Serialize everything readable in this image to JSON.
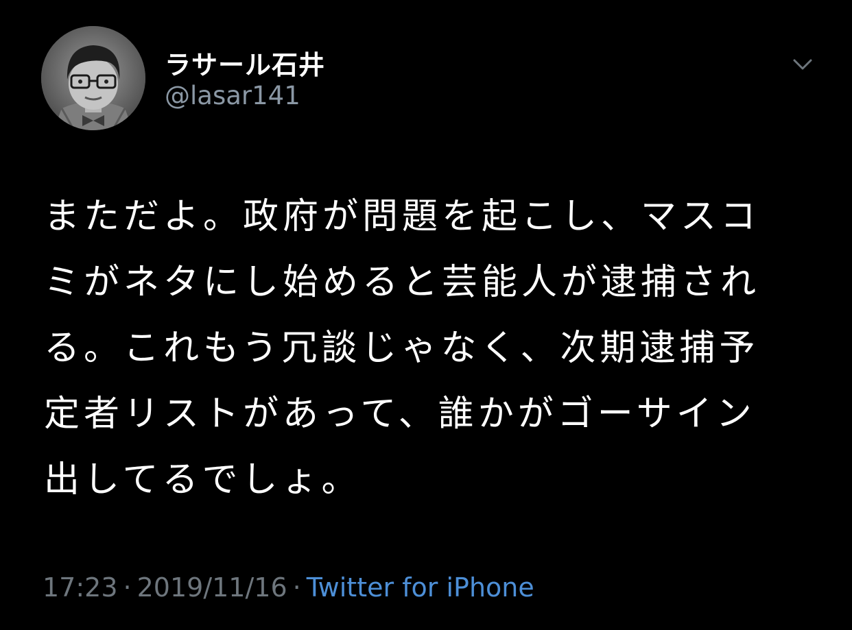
{
  "author": {
    "display_name": "ラサール石井",
    "handle": "@lasar141",
    "avatar_icon": "profile-photo"
  },
  "menu": {
    "icon": "chevron-down-icon"
  },
  "tweet": {
    "lines": [
      "まただよ。政府が問題を起こし、マスコ",
      "ミがネタにし始めると芸能人が逮捕され",
      "る。これもう冗談じゃなく、次期逮捕予",
      "定者リストがあって、誰かがゴーサイン",
      "出してるでしょ。"
    ]
  },
  "meta": {
    "time": "17:23",
    "date": "2019/11/16",
    "separator": "·",
    "source": "Twitter for iPhone"
  },
  "colors": {
    "background": "#000000",
    "text_primary": "#ffffff",
    "text_secondary": "#6e767d",
    "link": "#4d8fd7"
  }
}
